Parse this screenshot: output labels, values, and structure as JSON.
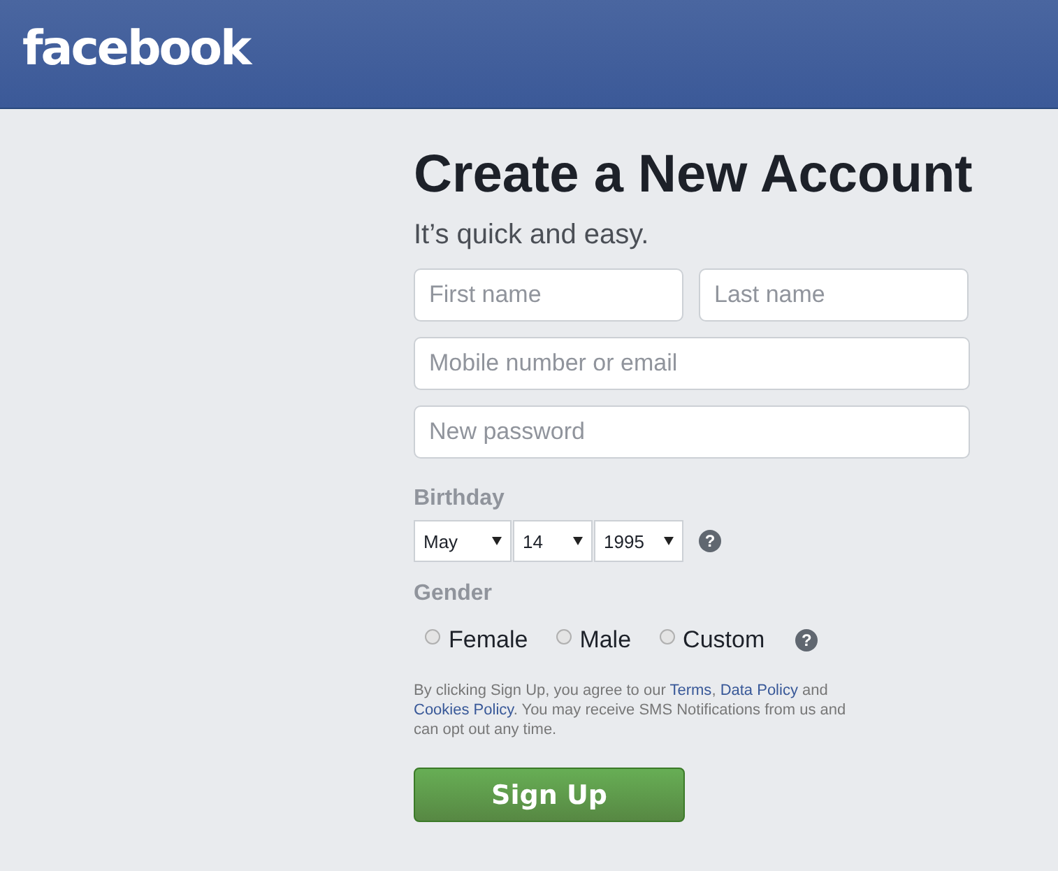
{
  "header": {
    "logo": "facebook"
  },
  "title": "Create a New Account",
  "subtitle": "It’s quick and easy.",
  "fields": [
    {
      "placeholder": "First name",
      "kind": "half"
    },
    {
      "placeholder": "Last name",
      "kind": "half"
    },
    {
      "placeholder": "Mobile number or email",
      "kind": "full"
    },
    {
      "placeholder": "New password",
      "kind": "full"
    }
  ],
  "birthday": {
    "label": "Birthday",
    "selects": [
      "May",
      "14",
      "1995"
    ],
    "help": "?"
  },
  "gender": {
    "label": "Gender",
    "options": [
      {
        "label": "Female",
        "selected": false
      },
      {
        "label": "Male",
        "selected": false
      },
      {
        "label": "Custom",
        "selected": false
      }
    ],
    "help": "?"
  },
  "legal": [
    {
      "kind": "text",
      "text": "By clicking Sign Up, you agree to our "
    },
    {
      "kind": "link",
      "text": "Terms"
    },
    {
      "kind": "text",
      "text": ", "
    },
    {
      "kind": "link",
      "text": "Data Policy"
    },
    {
      "kind": "text",
      "text": " and "
    },
    {
      "kind": "link",
      "text": "Cookies Policy"
    },
    {
      "kind": "text",
      "text": ". You may receive SMS Notifications from us and can opt out any time."
    }
  ],
  "button": "Sign Up"
}
